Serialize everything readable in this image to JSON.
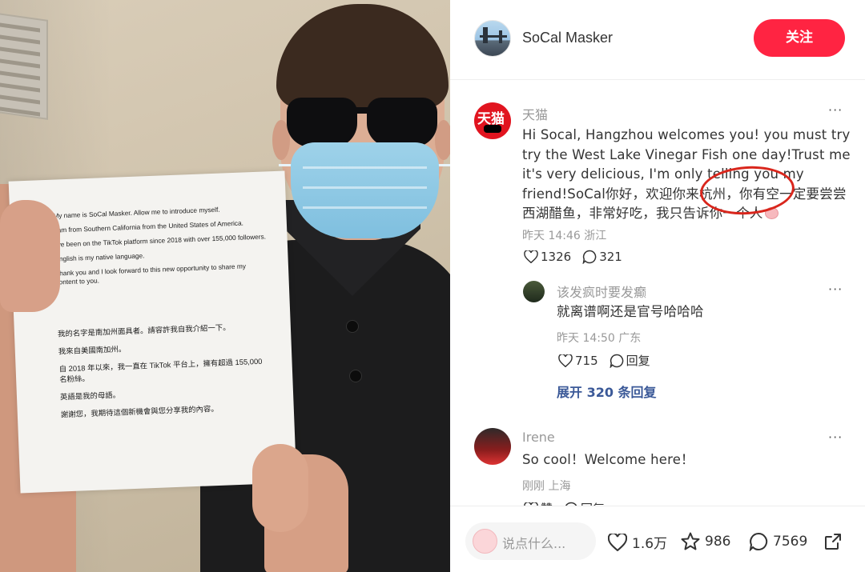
{
  "photo": {
    "paper_en": [
      "My name is SoCal Masker. Allow me to introduce myself.",
      "I am from Southern California from the United States of America.",
      "I've been on the TikTok platform since 2018 with over 155,000 followers.",
      "English is my native language.",
      "Thank you and I look forward to this new opportunity to share my content to you."
    ],
    "paper_zh": [
      "我的名字是南加州面具者。請容許我自我介紹一下。",
      "我來自美國南加州。",
      "自 2018 年以來，我一直在 TikTok 平台上，擁有超過 155,000 名粉絲。",
      "英語是我的母語。",
      "謝謝您，我期待這個新機會與您分享我的內容。"
    ]
  },
  "header": {
    "author_name": "SoCal Masker",
    "follow_label": "关注"
  },
  "comments": [
    {
      "user": "天猫",
      "avatar_text": "天猫",
      "text": "Hi Socal, Hangzhou welcomes you! you must try try the West Lake Vinegar Fish one day!Trust me it's very delicious, I'm only telling you my friend!SoCal你好，欢迎你来杭州，你有空一定要尝尝西湖醋鱼，非常好吃，我只告诉你一个人",
      "meta": "昨天 14:46 浙江",
      "likes": "1326",
      "replies": "321"
    },
    {
      "user": "该发疯时要发癫",
      "text": "就离谱啊还是官号哈哈哈",
      "meta": "昨天 14:50 广东",
      "likes": "715",
      "reply_label": "回复"
    },
    {
      "user": "Irene",
      "text": "So cool！Welcome here！",
      "meta": "刚刚 上海",
      "likes_label": "赞",
      "reply_label": "回复"
    }
  ],
  "expand_label": "展开 320 条回复",
  "footer": {
    "placeholder": "说点什么...",
    "likes": "1.6万",
    "collects": "986",
    "comments": "7569"
  },
  "colors": {
    "accent": "#ff2442",
    "link": "#3b5998",
    "highlight_circle": "#d9261c"
  }
}
